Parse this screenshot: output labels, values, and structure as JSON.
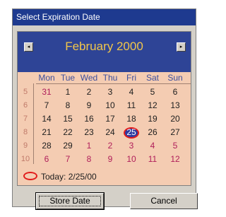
{
  "window": {
    "title": "Select Expiration Date"
  },
  "calendar": {
    "month_label": "February 2000",
    "prev_label": "◂",
    "next_label": "▸",
    "weekdays": [
      "Mon",
      "Tue",
      "Wed",
      "Thu",
      "Fri",
      "Sat",
      "Sun"
    ],
    "weeks": [
      {
        "week": "5",
        "days": [
          "31",
          "1",
          "2",
          "3",
          "4",
          "5",
          "6"
        ]
      },
      {
        "week": "6",
        "days": [
          "7",
          "8",
          "9",
          "10",
          "11",
          "12",
          "13"
        ]
      },
      {
        "week": "7",
        "days": [
          "14",
          "15",
          "16",
          "17",
          "18",
          "19",
          "20"
        ]
      },
      {
        "week": "8",
        "days": [
          "21",
          "22",
          "23",
          "24",
          "25",
          "26",
          "27"
        ]
      },
      {
        "week": "9",
        "days": [
          "28",
          "29",
          "1",
          "2",
          "3",
          "4",
          "5"
        ]
      },
      {
        "week": "10",
        "days": [
          "6",
          "7",
          "8",
          "9",
          "10",
          "11",
          "12"
        ]
      }
    ],
    "selected_day": "25",
    "today_label": "Today: 2/25/00"
  },
  "buttons": {
    "store_label": "Store Date",
    "cancel_label": "Cancel"
  },
  "colors": {
    "title_bar": "#1e3a8f",
    "header_bg": "#2e4496",
    "month_text": "#f2c64a",
    "body_bg": "#f4ccb2",
    "weekday_text": "#3d4f9c",
    "other_month_text": "#b01e5a",
    "selection_ring": "#e21c1c"
  }
}
